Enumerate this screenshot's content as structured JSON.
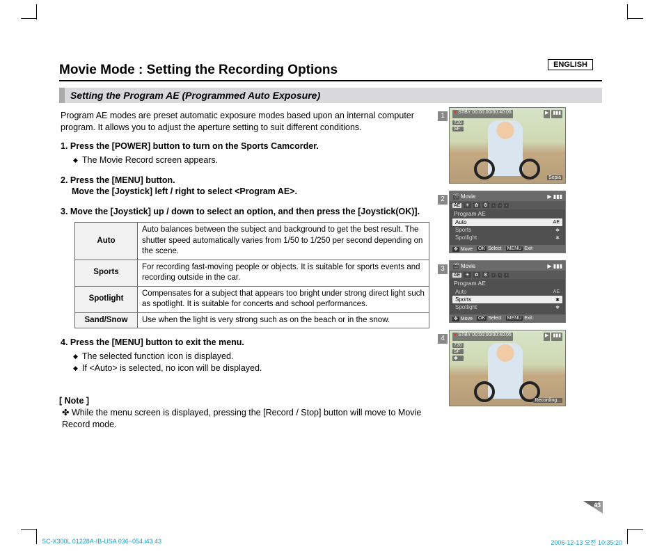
{
  "lang": "ENGLISH",
  "title": "Movie Mode : Setting the Recording Options",
  "subtitle": "Setting the Program AE (Programmed Auto Exposure)",
  "intro": "Program AE modes are preset automatic exposure modes based upon an internal computer program. It allows you to adjust the aperture setting to suit different conditions.",
  "steps": {
    "s1": {
      "head": "1.  Press the [POWER] button to turn on the Sports Camcorder.",
      "sub": "The Movie Record screen appears."
    },
    "s2": {
      "head": "2.  Press the [MENU] button.",
      "head2": "Move the [Joystick] left / right to select <Program AE>."
    },
    "s3": {
      "head": "3.  Move the [Joystick] up / down to select an option, and then press the [Joystick(OK)]."
    },
    "s4": {
      "head": "4.  Press the [MENU] button to exit the menu.",
      "sub1": "The selected function icon is displayed.",
      "sub2": "If <Auto> is selected, no icon will be displayed."
    }
  },
  "modes": [
    {
      "name": "Auto",
      "desc": "Auto balances between the subject and background to get the best result. The shutter speed automatically varies from 1/50 to 1/250 per second depending on the scene."
    },
    {
      "name": "Sports",
      "desc": "For recording fast-moving people or objects. It is suitable for sports events and recording outside in the car."
    },
    {
      "name": "Spotlight",
      "desc": "Compensates for a subject that appears too bright under strong direct light such as spotlight. It is suitable for concerts and school performances."
    },
    {
      "name": "Sand/Snow",
      "desc": "Use when the light is very strong such as on the beach or in the snow."
    }
  ],
  "note": {
    "head": "[ Note ]",
    "body": "While the menu screen is displayed, pressing the [Record / Stop] button will move to Movie Record mode."
  },
  "screens": {
    "cam": {
      "stby": "STBY",
      "time": "00:00:00/00:40:05",
      "res": "720",
      "sf": "SF",
      "sepia": "Sepia",
      "rec": "Recording..."
    },
    "menu": {
      "title": "Movie",
      "section": "Program AE",
      "items": [
        "Auto",
        "Sports",
        "Spotlight"
      ],
      "icons": [
        "AE",
        "☀",
        "✿",
        "⚙",
        "·",
        "·",
        "·"
      ],
      "bottom": {
        "move": "Move",
        "ok": "OK",
        "select": "Select",
        "menu": "MENU",
        "exit": "Exit"
      },
      "iconAE": "AE",
      "iconRun": "✱",
      "iconSpot": "✱"
    }
  },
  "page_num": "43",
  "footer": {
    "left": "SC-X300L 01228A-IB-USA 036~054.i43   43",
    "right": "2006-12-13   오전 10:35:20"
  }
}
